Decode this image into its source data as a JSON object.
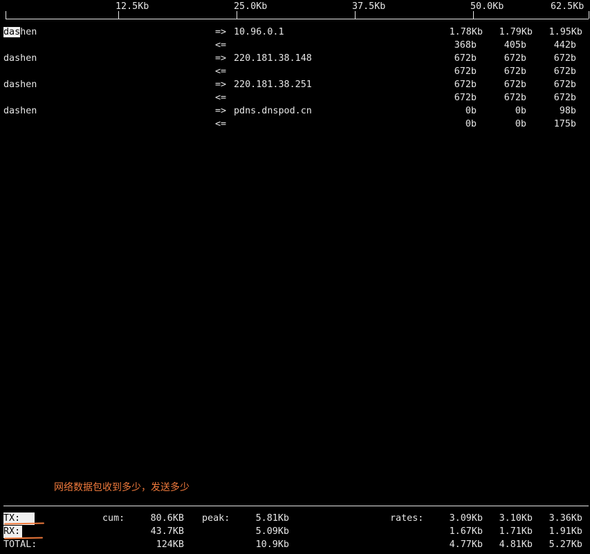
{
  "scale": {
    "labels": [
      "12.5Kb",
      "25.0Kb",
      "37.5Kb",
      "50.0Kb",
      "62.5Kb"
    ]
  },
  "flows": [
    {
      "host": "dashen",
      "host_highlight": "das",
      "host_rest": "hen",
      "out_arrow": "=>",
      "remote": "10.96.0.1",
      "in_arrow": "<=",
      "out_rates": [
        "1.78Kb",
        "1.79Kb",
        "1.95Kb"
      ],
      "in_rates": [
        "368b",
        "405b",
        "442b"
      ]
    },
    {
      "host": "dashen",
      "out_arrow": "=>",
      "remote": "220.181.38.148",
      "in_arrow": "<=",
      "out_rates": [
        "672b",
        "672b",
        "672b"
      ],
      "in_rates": [
        "672b",
        "672b",
        "672b"
      ]
    },
    {
      "host": "dashen",
      "out_arrow": "=>",
      "remote": "220.181.38.251",
      "in_arrow": "<=",
      "out_rates": [
        "672b",
        "672b",
        "672b"
      ],
      "in_rates": [
        "672b",
        "672b",
        "672b"
      ]
    },
    {
      "host": "dashen",
      "out_arrow": "=>",
      "remote": "pdns.dnspod.cn",
      "in_arrow": "<=",
      "out_rates": [
        "0b",
        "0b",
        "98b"
      ],
      "in_rates": [
        "0b",
        "0b",
        "175b"
      ]
    }
  ],
  "annotation": {
    "text": "网络数据包收到多少，发送多少",
    "color": "#f07a3c"
  },
  "totals": {
    "tx_label": "TX:",
    "rx_label": "RX:",
    "total_label": "TOTAL:",
    "cum_label": "cum:",
    "peak_label": "peak:",
    "rates_label": "rates:",
    "tx": {
      "cum": "80.6KB",
      "peak": "5.81Kb",
      "rates": [
        "3.09Kb",
        "3.10Kb",
        "3.36Kb"
      ]
    },
    "rx": {
      "cum": "43.7KB",
      "peak": "5.09Kb",
      "rates": [
        "1.67Kb",
        "1.71Kb",
        "1.91Kb"
      ]
    },
    "total": {
      "cum": "124KB",
      "peak": "10.9Kb",
      "rates": [
        "4.77Kb",
        "4.81Kb",
        "5.27Kb"
      ]
    }
  },
  "colors": {
    "background": "#000000",
    "foreground": "#e6e6e6",
    "accent": "#f07a3c"
  }
}
